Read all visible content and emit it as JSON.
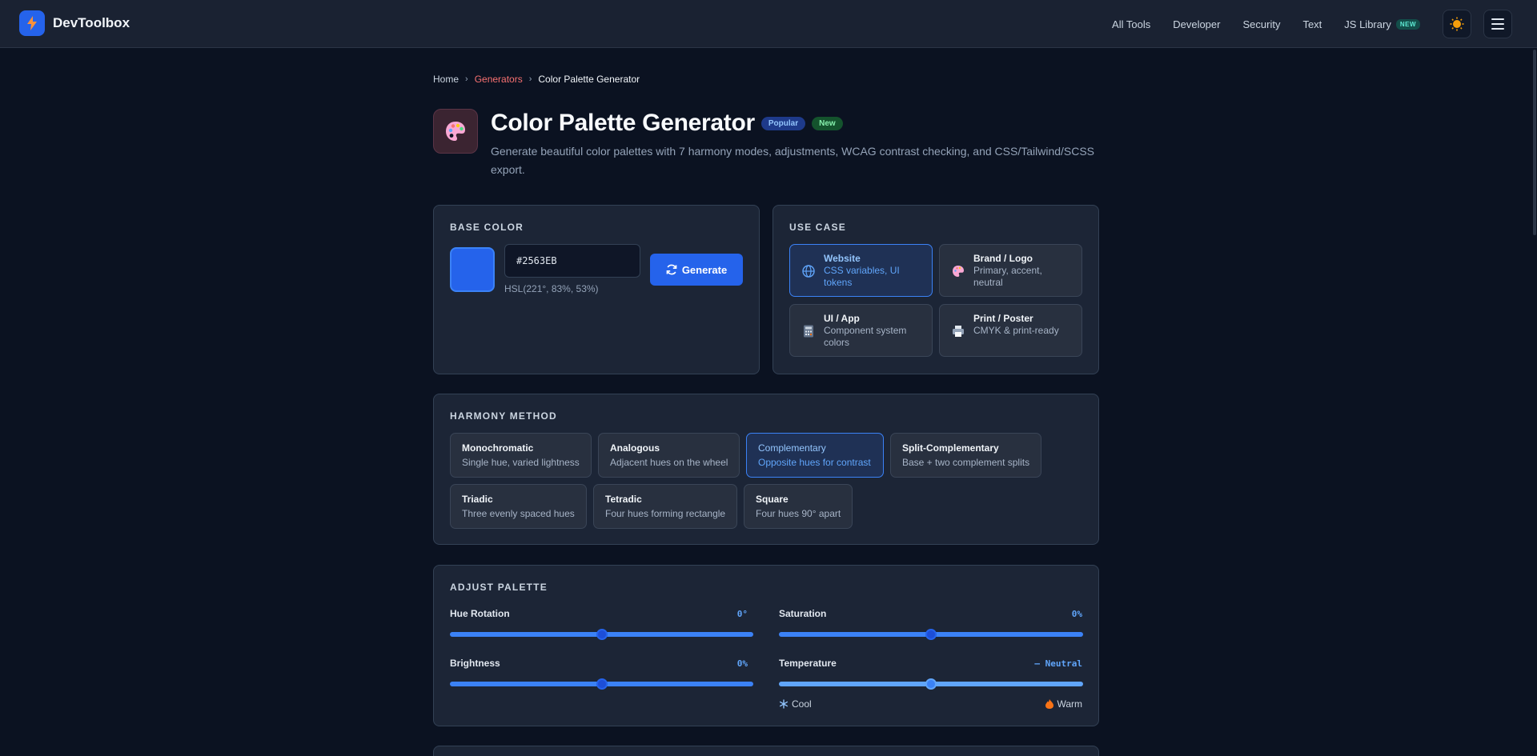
{
  "app": {
    "name": "DevToolbox"
  },
  "nav": {
    "items": [
      "All Tools",
      "Developer",
      "Security",
      "Text",
      "JS Library"
    ],
    "js_badge": "NEW"
  },
  "breadcrumb": {
    "home": "Home",
    "section": "Generators",
    "current": "Color Palette Generator"
  },
  "page": {
    "title": "Color Palette Generator",
    "badges": [
      "Popular",
      "New"
    ],
    "description": "Generate beautiful color palettes with 7 harmony modes, adjustments, WCAG contrast checking, and CSS/Tailwind/SCSS export."
  },
  "base_color": {
    "label": "BASE COLOR",
    "hex": "#2563EB",
    "hsl": "HSL(221°, 83%, 53%)",
    "swatch_color": "#2563EB",
    "generate_label": "Generate"
  },
  "use_case": {
    "label": "USE CASE",
    "selected": "Website",
    "options": [
      {
        "title": "Website",
        "sub": "CSS variables, UI tokens",
        "icon": "globe-icon"
      },
      {
        "title": "Brand / Logo",
        "sub": "Primary, accent, neutral",
        "icon": "palette-icon"
      },
      {
        "title": "UI / App",
        "sub": "Component system colors",
        "icon": "calculator-icon"
      },
      {
        "title": "Print / Poster",
        "sub": "CMYK & print-ready",
        "icon": "printer-icon"
      }
    ]
  },
  "harmony": {
    "label": "HARMONY METHOD",
    "selected": "Complementary",
    "options": [
      {
        "title": "Monochromatic",
        "sub": "Single hue, varied lightness"
      },
      {
        "title": "Analogous",
        "sub": "Adjacent hues on the wheel"
      },
      {
        "title": "Complementary",
        "sub": "Opposite hues for contrast"
      },
      {
        "title": "Split-Complementary",
        "sub": "Base + two complement splits"
      },
      {
        "title": "Triadic",
        "sub": "Three evenly spaced hues"
      },
      {
        "title": "Tetradic",
        "sub": "Four hues forming rectangle"
      },
      {
        "title": "Square",
        "sub": "Four hues 90° apart"
      }
    ]
  },
  "adjust": {
    "label": "ADJUST PALETTE",
    "hue": {
      "label": "Hue Rotation",
      "value": "0°",
      "level": 0.5
    },
    "saturation": {
      "label": "Saturation",
      "value": "0%",
      "level": 0.5
    },
    "brightness": {
      "label": "Brightness",
      "value": "0%",
      "level": 0.5
    },
    "temperature": {
      "label": "Temperature",
      "value": "— Neutral",
      "level": 0.5,
      "cool": "Cool",
      "warm": "Warm"
    }
  },
  "colors": {
    "accent": "#2563EB",
    "background": "#0B1221",
    "card": "#1C2536",
    "link_red": "#F87171"
  }
}
